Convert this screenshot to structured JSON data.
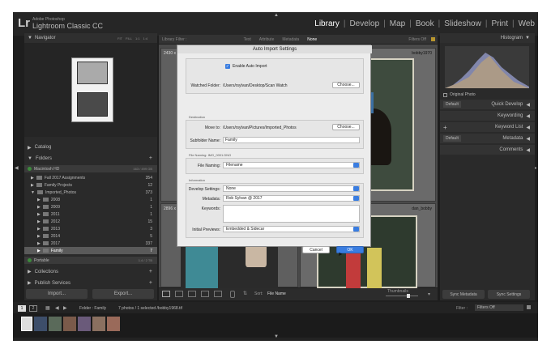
{
  "app": {
    "logo": "Lr",
    "brand_small": "Adobe Photoshop",
    "brand": "Lightroom Classic CC",
    "modules": [
      "Library",
      "Develop",
      "Map",
      "Book",
      "Slideshow",
      "Print",
      "Web"
    ],
    "active_module": "Library"
  },
  "left_panel": {
    "navigator_title": "Navigator",
    "navigator_zoom": [
      "FIT",
      "FILL",
      "1:1",
      "1:4"
    ],
    "catalog_title": "Catalog",
    "folders_title": "Folders",
    "volume": {
      "name": "Macintosh HD",
      "size": "163 / 499 GB"
    },
    "folders": [
      {
        "name": "Fall 2017 Assignments",
        "count": "354"
      },
      {
        "name": "Family Projects",
        "count": "12"
      },
      {
        "name": "Imported_Photos",
        "count": "373"
      },
      {
        "name": "2008",
        "count": "1"
      },
      {
        "name": "2009",
        "count": "1"
      },
      {
        "name": "2011",
        "count": "1"
      },
      {
        "name": "2012",
        "count": "15"
      },
      {
        "name": "2013",
        "count": "3"
      },
      {
        "name": "2014",
        "count": "5"
      },
      {
        "name": "2017",
        "count": "337"
      },
      {
        "name": "Family",
        "count": "7"
      }
    ],
    "volume2": {
      "name": "Portable",
      "size": "1.4 / 2 TB"
    },
    "collections_title": "Collections",
    "publish_title": "Publish Services",
    "import_label": "Import...",
    "export_label": "Export..."
  },
  "filter_bar": {
    "label": "Library Filter :",
    "options": [
      "Text",
      "Attribute",
      "Metadata",
      "None"
    ],
    "filters_off": "Filters Off"
  },
  "grid": {
    "cells": [
      {
        "size": "2430 x",
        "name": "bobby1970"
      },
      {
        "size": "2896 x",
        "name": "dan_bobby"
      }
    ]
  },
  "toolbar": {
    "sort_label": "Sort:",
    "sort_value": "File Name",
    "thumbnails": "Thumbnails"
  },
  "right_panel": {
    "histogram_title": "Histogram",
    "original_photo": "Original Photo",
    "default_label": "Default",
    "items": [
      "Quick Develop",
      "Keywording",
      "Keyword List",
      "Metadata",
      "Comments"
    ],
    "sync_metadata": "Sync Metadata",
    "sync_settings": "Sync Settings"
  },
  "dialog": {
    "title": "Auto Import Settings",
    "enable_label": "Enable Auto Import",
    "watched_folder_label": "Watched Folder:",
    "watched_folder_value": "/Users/rsylvan/Desktop/Scan Watch",
    "choose_label": "Choose...",
    "destination_header": "Destination",
    "move_to_label": "Move to:",
    "move_to_value": "/Users/rsylvan/Pictures/Imported_Photos",
    "subfolder_label": "Subfolder Name:",
    "subfolder_value": "Family",
    "file_naming_header": "File Naming: IMG_0001.DNG",
    "file_naming_label": "File Naming:",
    "file_naming_value": "Filename",
    "information_header": "Information",
    "develop_label": "Develop Settings:",
    "develop_value": "None",
    "metadata_label": "Metadata:",
    "metadata_value": "Rob Sylvan @ 2017",
    "keywords_label": "Keywords:",
    "previews_label": "Initial Previews:",
    "previews_value": "Embedded & Sidecar",
    "cancel_label": "Cancel",
    "ok_label": "OK"
  },
  "filmstrip_bar": {
    "page1": "1",
    "page2": "2",
    "source": "Folder : Family",
    "count": "7 photos / 1 selected /bobby1968.tif",
    "filter_label": "Filter :",
    "filter_value": "Filters Off"
  },
  "colors": {
    "accent": "#3a7de0",
    "panel": "#2a2a2a",
    "selected_row": "#5a5a5a"
  }
}
